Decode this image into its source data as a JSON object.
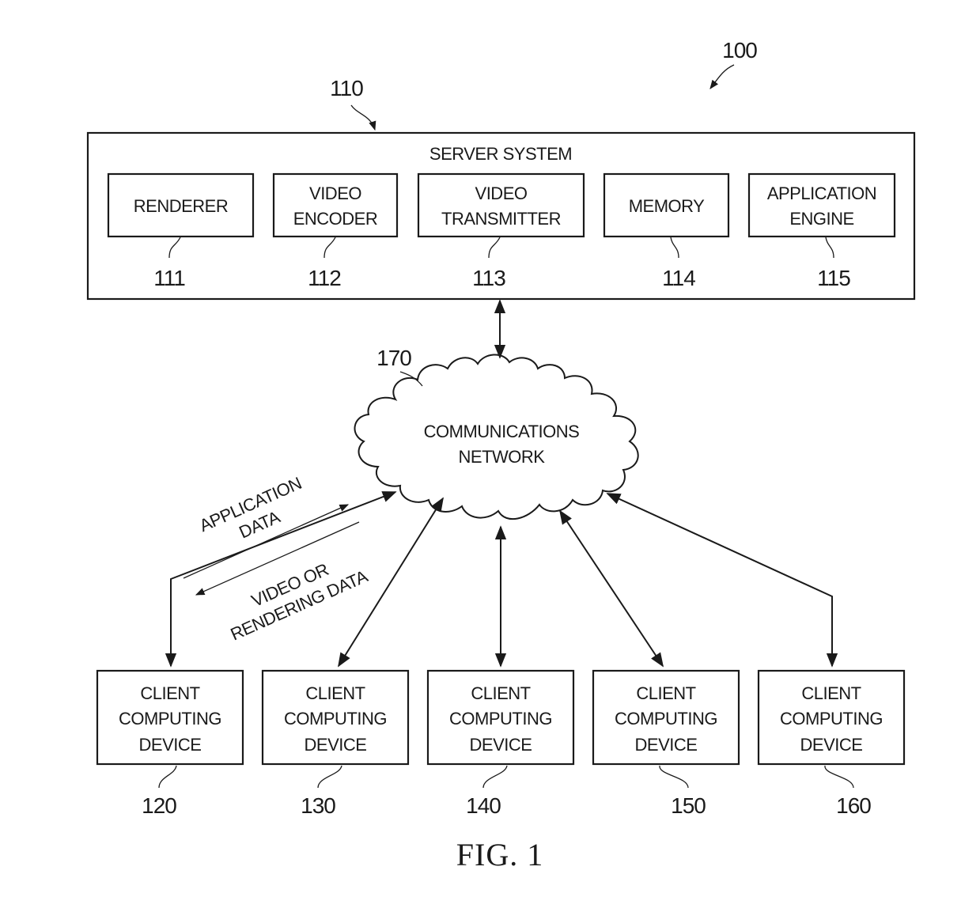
{
  "figure": {
    "system_ref": "100",
    "caption": "FIG. 1"
  },
  "server": {
    "ref": "110",
    "title": "SERVER SYSTEM",
    "components": [
      {
        "ref": "111",
        "lines": [
          "RENDERER"
        ]
      },
      {
        "ref": "112",
        "lines": [
          "VIDEO",
          "ENCODER"
        ]
      },
      {
        "ref": "113",
        "lines": [
          "VIDEO",
          "TRANSMITTER"
        ]
      },
      {
        "ref": "114",
        "lines": [
          "MEMORY"
        ]
      },
      {
        "ref": "115",
        "lines": [
          "APPLICATION",
          "ENGINE"
        ]
      }
    ]
  },
  "network": {
    "ref": "170",
    "lines": [
      "COMMUNICATIONS",
      "NETWORK"
    ]
  },
  "flow_labels": {
    "upstream": [
      "APPLICATION",
      "DATA"
    ],
    "downstream": [
      "VIDEO OR",
      "RENDERING DATA"
    ]
  },
  "clients": [
    {
      "ref": "120",
      "lines": [
        "CLIENT",
        "COMPUTING",
        "DEVICE"
      ]
    },
    {
      "ref": "130",
      "lines": [
        "CLIENT",
        "COMPUTING",
        "DEVICE"
      ]
    },
    {
      "ref": "140",
      "lines": [
        "CLIENT",
        "COMPUTING",
        "DEVICE"
      ]
    },
    {
      "ref": "150",
      "lines": [
        "CLIENT",
        "COMPUTING",
        "DEVICE"
      ]
    },
    {
      "ref": "160",
      "lines": [
        "CLIENT",
        "COMPUTING",
        "DEVICE"
      ]
    }
  ]
}
